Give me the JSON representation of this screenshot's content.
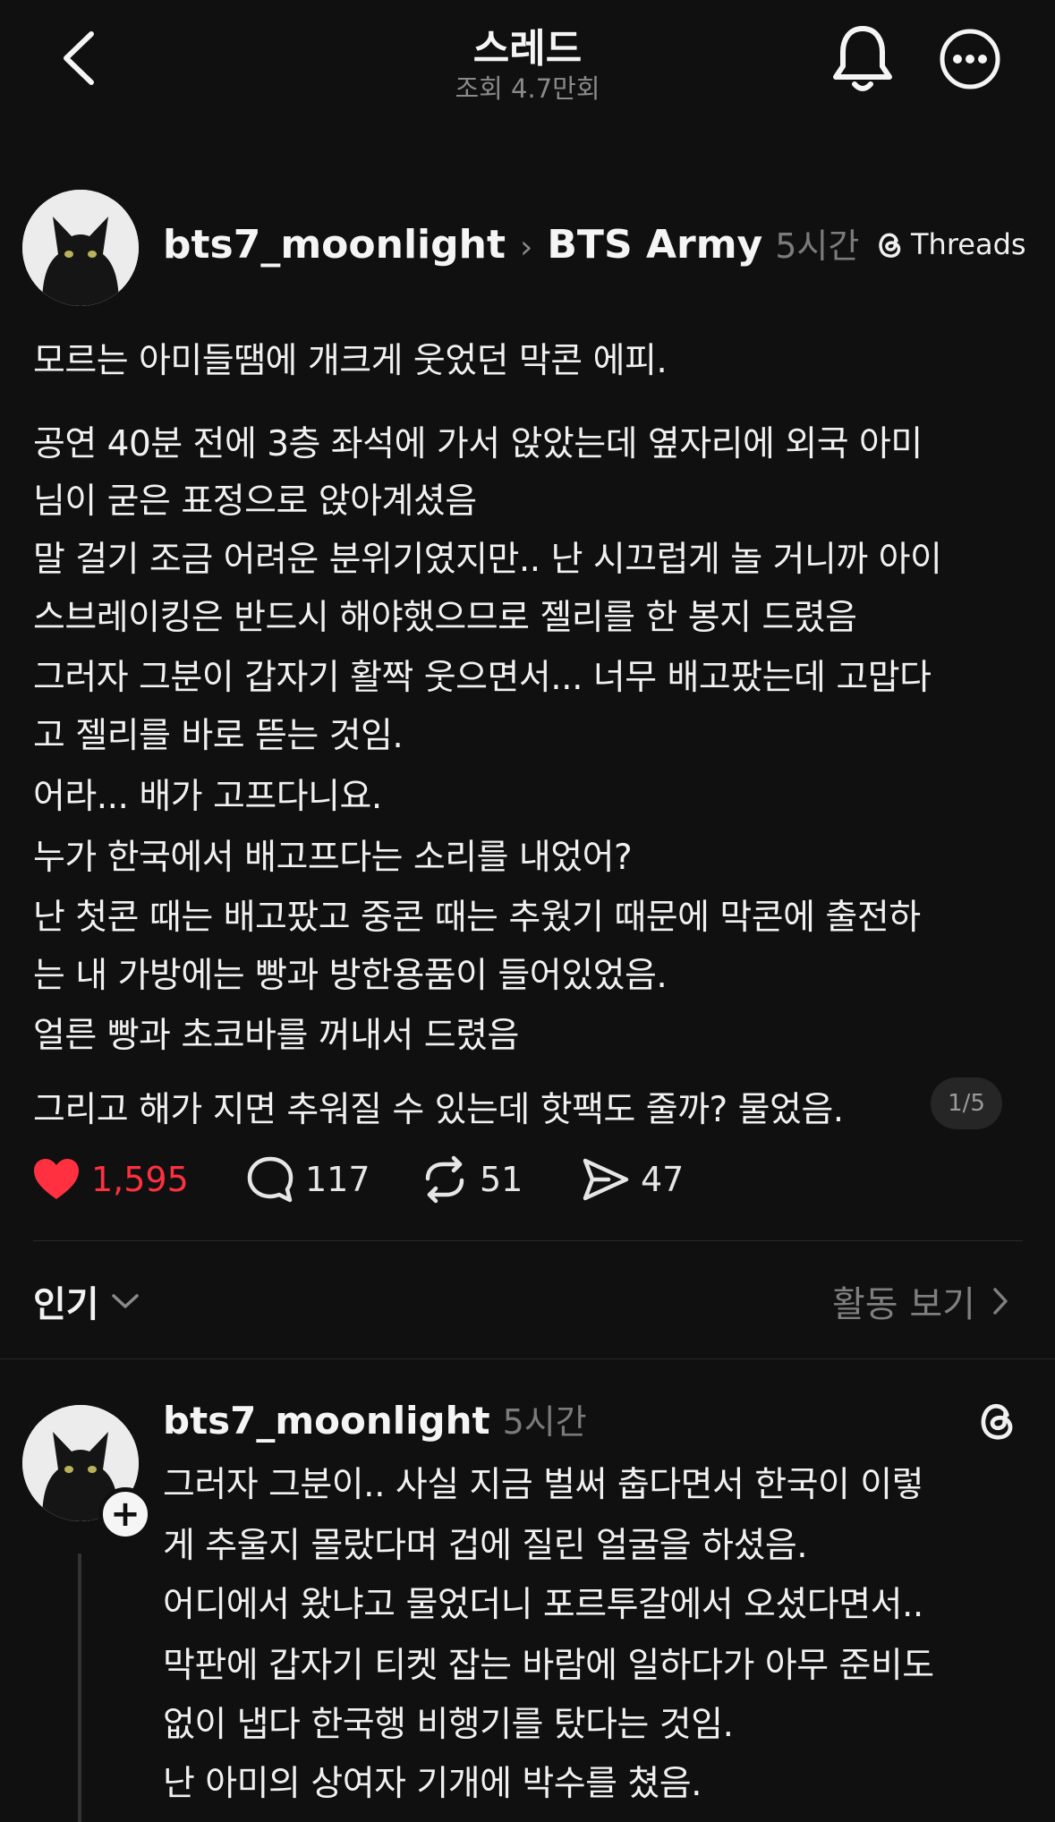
{
  "header": {
    "title": "스레드",
    "subtitle": "조회 4.7만회"
  },
  "post": {
    "username": "bts7_moonlight",
    "community": "BTS Army",
    "time": "5시간",
    "source_badge": "Threads",
    "lines": [
      "모르는 아미들땜에 개크게 웃었던 막콘 에피.",
      "공연 40분 전에 3층 좌석에 가서 앉았는데 옆자리에 외국 아미",
      "님이 굳은 표정으로 앉아계셨음",
      "말 걸기 조금 어려운 분위기였지만.. 난 시끄럽게 놀 거니까 아이",
      "스브레이킹은 반드시 해야했으므로 젤리를 한 봉지 드렸음",
      "그러자 그분이 갑자기 활짝 웃으면서... 너무 배고팠는데 고맙다",
      "고 젤리를 바로 뜯는 것임.",
      "어라... 배가 고프다니요.",
      "누가 한국에서 배고프다는 소리를 내었어?",
      "난 첫콘 때는 배고팠고 중콘 때는 추웠기 때문에 막콘에 출전하",
      "는 내 가방에는 빵과 방한용품이 들어있었음.",
      "얼른 빵과 초코바를 꺼내서 드렸음",
      "그리고 해가 지면 추워질 수 있는데 핫팩도 줄까? 물었음."
    ],
    "page_indicator": "1/5",
    "likes": "1,595",
    "comments": "117",
    "reposts": "51",
    "shares": "47"
  },
  "sort": {
    "label": "인기",
    "activity_label": "활동 보기"
  },
  "reply": {
    "username": "bts7_moonlight",
    "time": "5시간",
    "lines": [
      "그러자 그분이.. 사실 지금 벌써 춥다면서 한국이 이렇",
      "게 추울지 몰랐다며 겁에 질린 얼굴을 하셨음.",
      "어디에서 왔냐고 물었더니 포르투갈에서 오셨다면서..",
      "막판에 갑자기 티켓 잡는 바람에 일하다가 아무 준비도",
      "없이 냅다 한국행 비행기를 탔다는 것임.",
      "난 아미의 상여자 기개에 박수를 쳤음."
    ]
  },
  "colors": {
    "background": "#101010",
    "like_red": "#ff3040",
    "muted": "#7b7b7b"
  },
  "icons": [
    "back-icon",
    "bell-icon",
    "more-icon",
    "threads-logo-icon",
    "heart-icon",
    "comment-icon",
    "repost-icon",
    "share-icon",
    "chevron-down-icon",
    "chevron-right-icon",
    "plus-icon"
  ]
}
